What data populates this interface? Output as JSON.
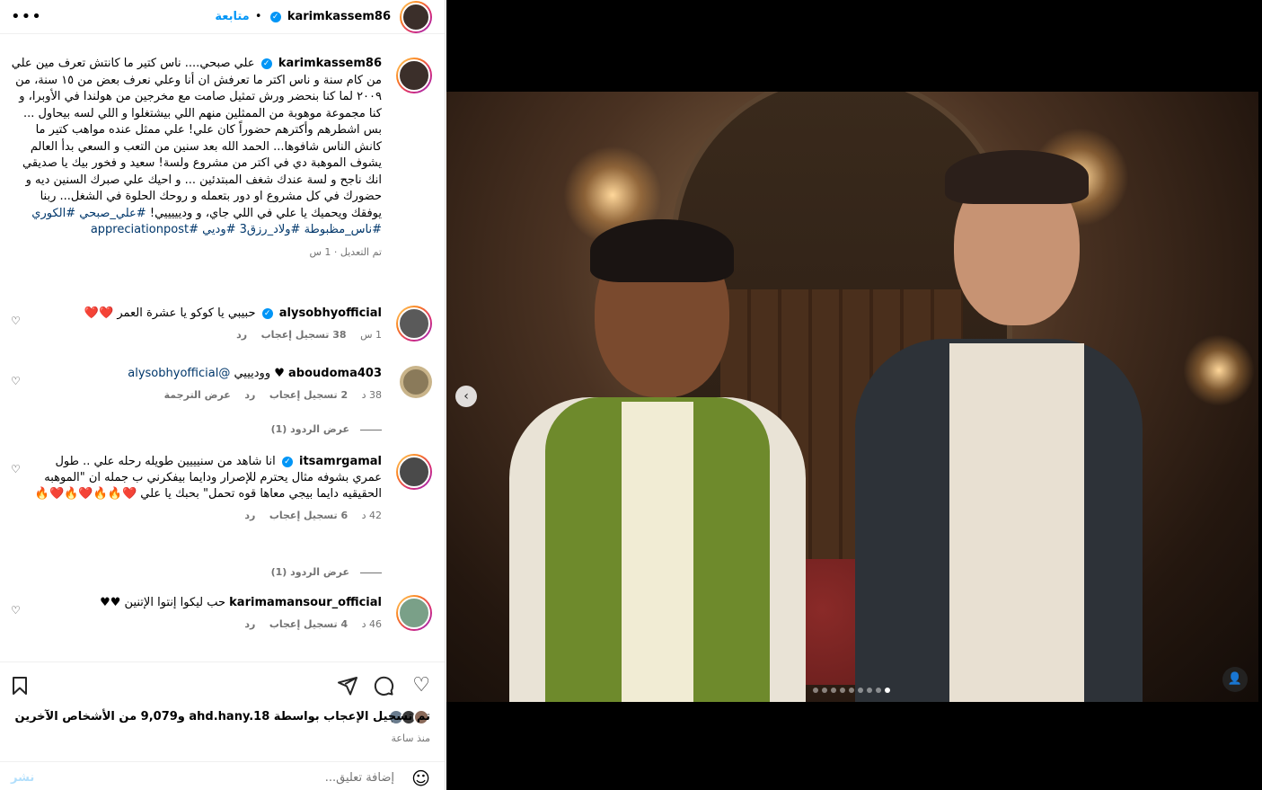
{
  "header": {
    "username": "karimkassem86",
    "follow_label": "متابعة",
    "more_icon": "more-icon"
  },
  "caption": {
    "username": "karimkassem86",
    "text": "علي صبحي.... ناس كتير ما كانتش تعرف مين علي من كام سنة و ناس اكتر ما تعرفش ان أنا وعلي نعرف بعض من ١٥ سنة، من ٢٠٠٩ لما كنا بنحضر ورش تمثيل صامت مع مخرجين من هولندا في الأوبرا، و كنا مجموعة موهوبة من الممثلين منهم اللي بيشتغلوا و اللي لسه بيحاول ... بس اشطرهم وأكترهم حضوراً كان علي! علي ممثل عنده مواهب كتير ما كانش الناس شافوها... الحمد الله بعد سنين من التعب و السعي بدأ العالم يشوف الموهبة دي في اكتر من مشروع ولسة! سعيد و فخور بيك يا صديقي انك ناجح و لسة عندك شغف المبتدئين ... و احيك علي صبرك السنين ديه و حضورك في كل مشروع او دور بتعمله و روحك الحلوة في الشغل... ربنا يوفقك ويحميك يا علي في اللي جاي، و وديييييي!",
    "hashtags": "#علي_صبحي #الكوري #ناس_مظبوطة #ولاد_رزق3 #وديي #appreciationpost",
    "edited": "تم التعديل · 1 س"
  },
  "comments": [
    {
      "username": "alysobhyofficial",
      "verified": true,
      "text": "حبيبي يا كوكو يا عشرة العمر ❤️❤️",
      "time": "1 س",
      "likes": "38 تسجيل إعجاب",
      "reply": "رد"
    },
    {
      "username": "aboudoma403",
      "verified": false,
      "text": "♥ ووديييي",
      "mention": "@alysobhyofficial",
      "time": "38 د",
      "likes": "2 تسجيل إعجاب",
      "reply": "رد",
      "translate": "عرض الترجمة",
      "view_replies": "عرض الردود (1)"
    },
    {
      "username": "itsamrgamal",
      "verified": true,
      "text": "انا شاهد من سنيييين طويله رحله علي .. طول عمري بشوفه مثال يحترم للإصرار ودايما بيفكرني ب جمله ان \"الموهبه الحقيقيه دايما بيجي معاها قوه تحمل\" بحبك يا علي ❤️🔥🔥❤️🔥❤️🔥",
      "time": "42 د",
      "likes": "6 تسجيل إعجاب",
      "reply": "رد",
      "view_replies": "عرض الردود (1)"
    },
    {
      "username": "karimamansour_official",
      "verified": false,
      "text": "حب ليكوا إنتوا الإتنين ♥♥",
      "time": "46 د",
      "likes": "4 تسجيل إعجاب",
      "reply": "رد"
    }
  ],
  "actions": {
    "like_icon": "heart-icon",
    "comment_icon": "comment-icon",
    "share_icon": "share-icon",
    "save_icon": "bookmark-icon"
  },
  "likes_text": "تم تسجيل الإعجاب بواسطة ahd.hany.18 و9,079 من الأشخاص الآخرين",
  "post_time": "منذ ساعة",
  "add_comment": {
    "placeholder": "إضافة تعليق...",
    "post_label": "نشر"
  },
  "media": {
    "carousel_total": 9,
    "carousel_active": 9
  },
  "colors": {
    "accent": "#0095f6",
    "link": "#00376b",
    "muted": "#737373",
    "like_red": "#ff3040"
  }
}
